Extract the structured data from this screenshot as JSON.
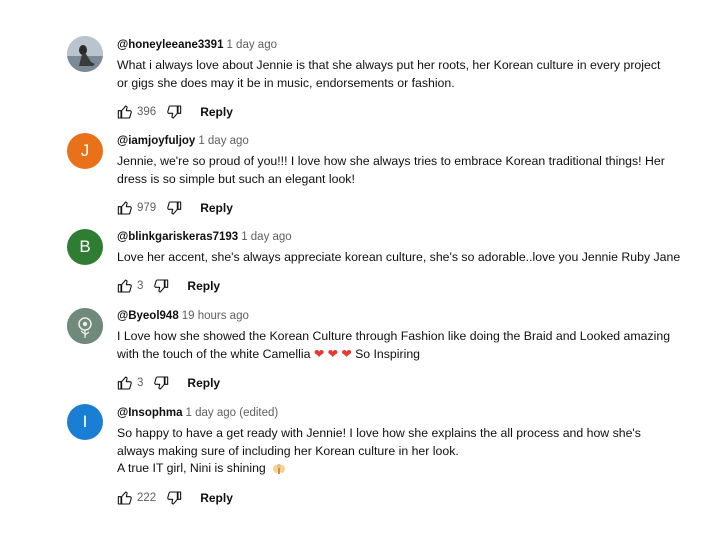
{
  "colors": {
    "avatar_j": "#e8711a",
    "avatar_b": "#2e7d32",
    "avatar_i": "#1a7fd4",
    "heart": "#e53935"
  },
  "comments": [
    {
      "author": "@honeyleeane3391",
      "time": "1 day ago",
      "avatar_letter": "",
      "avatar_type": "photo",
      "lines": [
        "What i always love about Jennie is that she always put her roots, her Korean culture in  every project",
        "or gigs she does may it be in music, endorsements or fashion."
      ],
      "likes": "396",
      "reply_label": "Reply"
    },
    {
      "author": "@iamjoyfuljoy",
      "time": "1 day ago",
      "avatar_letter": "J",
      "lines": [
        "Jennie, we're so proud of you!!! I love how she always tries to embrace Korean traditional things! Her",
        "dress is so simple but such an elegant look!"
      ],
      "likes": "979",
      "reply_label": "Reply"
    },
    {
      "author": "@blinkgariskeras7193",
      "time": "1 day ago",
      "avatar_letter": "B",
      "lines": [
        "Love her accent, she's always appreciate korean culture, she's so adorable..love you Jennie Ruby Jane"
      ],
      "likes": "3",
      "reply_label": "Reply"
    },
    {
      "author": "@Byeol948",
      "time": "19 hours ago",
      "avatar_letter": "",
      "avatar_type": "photo-flower",
      "lines": [
        "I Love how she showed the Korean Culture through Fashion like doing the Braid and Looked amazing",
        "with the touch of the white Camellia"
      ],
      "line_suffix": "So Inspiring",
      "hearts": 3,
      "likes": "3",
      "reply_label": "Reply"
    },
    {
      "author": "@Insophma",
      "time": "1 day ago (edited)",
      "avatar_letter": "I",
      "lines": [
        "So happy to have a get ready with Jennie! I love how she explains the all process and how she's",
        "always making sure of including her Korean culture in her look.",
        "A true IT girl, Nini is shining"
      ],
      "emoji": "fairy",
      "likes": "222",
      "reply_label": "Reply"
    }
  ]
}
